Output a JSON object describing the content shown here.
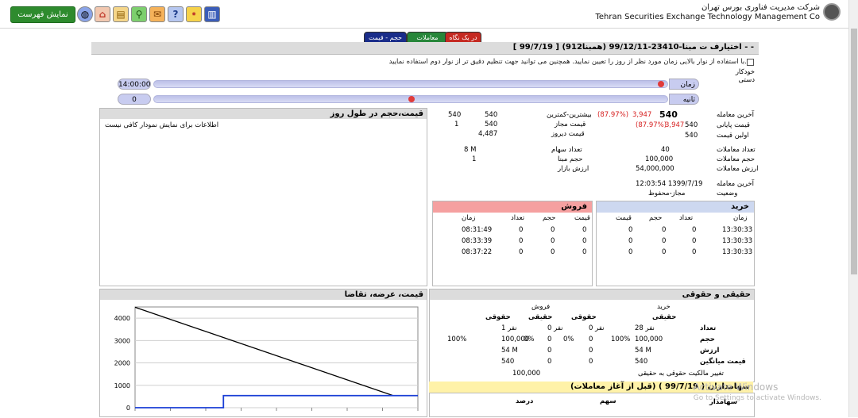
{
  "topbar": {
    "show_list_label": "نمایش فهرست",
    "company_fa": "شرکت مدیریت فناوری بورس تهران",
    "company_en": "Tehran Securities Exchange Technology Management Co"
  },
  "tabs": {
    "at_a_glance": "در یک نگاه",
    "trades": "معاملات",
    "volume_price": "حجم - قیمت"
  },
  "instrument": {
    "title": "اختیارف ت مبنا-23410-99/12/11 (همبنا912) [ 99/7/19 ] - -"
  },
  "replay": {
    "description": "با استفاده از نوار بالایی زمان مورد نظر از روز را تعیین نمایید. همچنین می توانید جهت تنظیم دقیق تر از نوار دوم استفاده نمایید.",
    "auto_label": "خودکار",
    "manual_label": "دستی",
    "time_label": "زمان",
    "time_value": "14:00:00",
    "time_fraction": 0.99,
    "second_label": "ثانیه",
    "second_value": "0",
    "second_fraction": 0.5
  },
  "info": {
    "last_trade_label": "آخرین معامله",
    "last_trade_value": "540",
    "last_trade_change": "3,947",
    "last_trade_pct": "(87.97%)",
    "close_label": "قیمت پایانی",
    "close_value": "540",
    "close_change": "3,947",
    "close_pct": "(87.97%)",
    "first_label": "اولین قیمت",
    "first_value": "540",
    "highlow_label": "بیشترین-کمترین",
    "high": "540",
    "low": "540",
    "allowed_label": "قیمت مجاز",
    "allowed_high": "540",
    "allowed_low": "1",
    "yesterday_label": "قیمت دیروز",
    "yesterday_value": "4,487",
    "trades_count_label": "تعداد معاملات",
    "trades_count": "40",
    "volume_label": "حجم معاملات",
    "volume": "100,000",
    "value_label": "ارزش معاملات",
    "value": "54,000,000",
    "shares_label": "تعداد سهام",
    "shares": "8 M",
    "base_volume_label": "حجم مبنا",
    "base_volume": "1",
    "market_value_label": "ارزش بازار",
    "last_deal_label": "آخرین معامله",
    "last_deal_value": "12:03:54 1399/7/19",
    "status_label": "وضعیت",
    "status_value": "مجاز-محفوظ"
  },
  "intraday": {
    "title": "قیمت،حجم در طول روز",
    "message": "اطلاعات برای نمایش نمودار کافی نیست"
  },
  "orderbook": {
    "buy_title": "خرید",
    "sell_title": "فروش",
    "buy_headers": [
      "زمان",
      "تعداد",
      "حجم",
      "قیمت"
    ],
    "sell_headers": [
      "قیمت",
      "حجم",
      "تعداد",
      "زمان"
    ],
    "buy_rows": [
      [
        "13:30:33",
        "0",
        "0",
        "0"
      ],
      [
        "13:30:33",
        "0",
        "0",
        "0"
      ],
      [
        "13:30:33",
        "0",
        "0",
        "0"
      ]
    ],
    "sell_rows": [
      [
        "0",
        "0",
        "0",
        "08:31:49"
      ],
      [
        "0",
        "0",
        "0",
        "08:33:39"
      ],
      [
        "0",
        "0",
        "0",
        "08:37:22"
      ]
    ]
  },
  "supply_demand": {
    "title": "قیمت، عرضه، تقاضا"
  },
  "legal_real": {
    "title": "حقیقی و حقوقی",
    "buy": "خرید",
    "sell": "فروش",
    "real": "حقیقی",
    "legal": "حقوقی",
    "rows": [
      {
        "label": "تعداد",
        "buy_real": "28 نفر",
        "buy_legal": "0 نفر",
        "sell_real": "0 نفر",
        "sell_legal": "1 نفر"
      },
      {
        "label": "حجم",
        "buy_real": "100,000",
        "buy_real_pct": "100%",
        "buy_legal": "0",
        "buy_legal_pct": "0%",
        "sell_real": "0",
        "sell_real_pct": "0%",
        "sell_legal": "100,000",
        "sell_legal_pct": "100%"
      },
      {
        "label": "ارزش",
        "buy_real": "54 M",
        "buy_legal": "0",
        "sell_real": "0",
        "sell_legal": "54 M"
      },
      {
        "label": "قیمت میانگین",
        "buy_real": "540",
        "buy_legal": "0",
        "sell_real": "0",
        "sell_legal": "540"
      }
    ],
    "change_label": "تغییر مالکیت حقوقی به حقیقی",
    "change_value": "100,000"
  },
  "shareholders": {
    "title": "سهامداران ( 99/7/19 ) (قبل از آغاز معاملات)",
    "col_holder": "سهامدار",
    "col_shares": "سهم",
    "col_pct": "درصد"
  },
  "watermark": {
    "line1": "Activate Windows",
    "line2": "Go to Settings to activate Windows."
  },
  "chart_data": {
    "type": "line",
    "title": "قیمت، عرضه، تقاضا",
    "ylim": [
      0,
      4500
    ],
    "yticks": [
      0,
      1000,
      2000,
      3000,
      4000
    ],
    "x_divisions": 8,
    "series": [
      {
        "color": "#000000",
        "x": [
          0,
          7.3
        ],
        "y": [
          4487,
          540
        ]
      },
      {
        "color": "#1a3fd6",
        "x": [
          0,
          2.5,
          2.5,
          8
        ],
        "y": [
          0,
          0,
          540,
          540
        ]
      }
    ]
  }
}
